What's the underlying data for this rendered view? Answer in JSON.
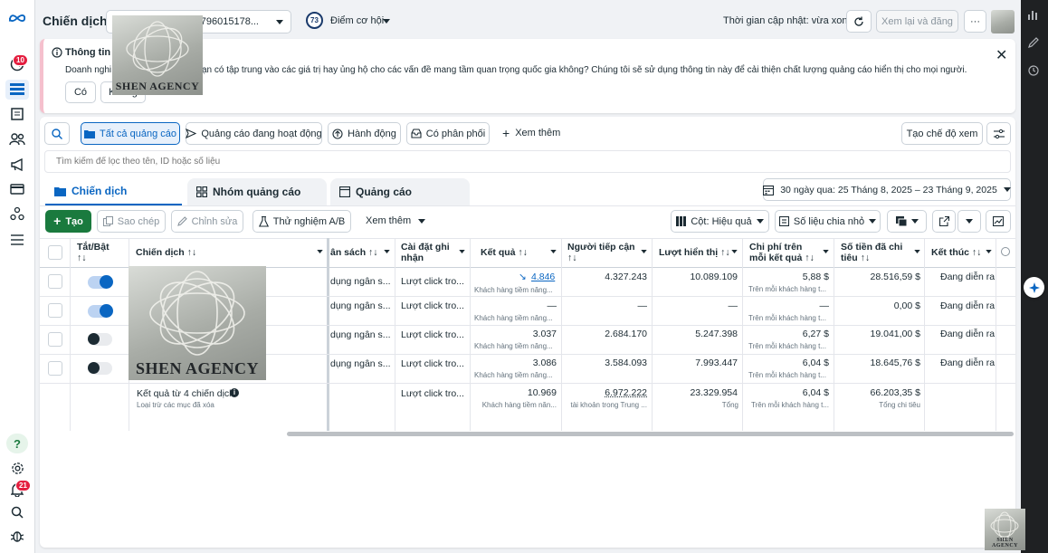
{
  "header": {
    "title": "Chiến dịch",
    "account_selector": "(1796015178...",
    "opportunity_score": "73",
    "opportunity_label": "Điểm cơ hội",
    "update_time": "Thời gian cập nhật: vừa xong",
    "review_publish": "Xem lại và đăng",
    "more": "···"
  },
  "banner": {
    "title": "Thông tin t",
    "text_left": "Doanh nghi",
    "text_right": "ạn có tập trung vào các giá trị hay ủng hộ cho các vấn đề mang tầm quan trọng quốc gia không? Chúng tôi sẽ sử dụng thông tin này để cải thiện chất lượng quảng cáo hiển thị cho mọi người.",
    "yes": "Có",
    "no": "Không"
  },
  "watermark": {
    "text": "SHEN AGENCY"
  },
  "filters": {
    "all_ads": "Tất cả quảng cáo",
    "active_ads": "Quảng cáo đang hoạt động",
    "actions": "Hành động",
    "delivery": "Có phân phối",
    "see_more": "Xem thêm",
    "create_view": "Tạo chế độ xem",
    "search_placeholder": "Tìm kiếm để lọc theo tên, ID hoặc số liệu"
  },
  "tabs": {
    "campaigns": "Chiến dịch",
    "adsets": "Nhóm quảng cáo",
    "ads": "Quảng cáo"
  },
  "date_range": "30 ngày qua: 25 Tháng 8, 2025 – 23 Tháng 9, 2025",
  "toolbar": {
    "create": "Tạo",
    "duplicate": "Sao chép",
    "edit": "Chỉnh sửa",
    "ab_test": "Thử nghiệm A/B",
    "more": "Xem thêm",
    "columns": "Cột: Hiệu quả",
    "breakdown": "Số liệu chia nhỏ"
  },
  "table": {
    "headers": {
      "onoff": "Tắt/Bật",
      "onoff_sort": "↑↓",
      "campaign": "Chiến dịch ↑↓",
      "budget": "ân sách ↑↓",
      "attribution": "Cài đặt ghi nhận",
      "results": "Kết quả ↑↓",
      "reach": "Người tiếp cận",
      "reach_sort": "↑↓",
      "impressions": "Lượt hiển thị ↑↓",
      "cost_per_result": "Chi phí trên mỗi kết quả ↑↓",
      "amount_spent": "Số tiền đã chi tiêu ↑↓",
      "end": "Kết thúc ↑↓"
    },
    "rows": [
      {
        "on": true,
        "budget": "dụng ngân s...",
        "attribution": "Lượt click tro...",
        "results": "4.846",
        "results_sub": "Khách hàng tiềm năng...",
        "reach": "4.327.243",
        "impressions": "10.089.109",
        "cpr": "5,88 $",
        "cpr_sub": "Trên mỗi khách hàng t...",
        "spent": "28.516,59 $",
        "end": "Đang diễn ra"
      },
      {
        "on": true,
        "budget": "dụng ngân s...",
        "attribution": "Lượt click tro...",
        "results": "—",
        "results_sub": "Khách hàng tiềm năng...",
        "reach": "—",
        "impressions": "—",
        "cpr": "—",
        "cpr_sub": "Trên mỗi khách hàng t...",
        "spent": "0,00 $",
        "end": "Đang diễn ra"
      },
      {
        "on": false,
        "budget": "dụng ngân s...",
        "attribution": "Lượt click tro...",
        "results": "3.037",
        "results_sub": "Khách hàng tiềm năng...",
        "reach": "2.684.170",
        "impressions": "5.247.398",
        "cpr": "6,27 $",
        "cpr_sub": "Trên mỗi khách hàng t...",
        "spent": "19.041,00 $",
        "end": "Đang diễn ra"
      },
      {
        "on": false,
        "budget": "dụng ngân s...",
        "attribution": "Lượt click tro...",
        "results": "3.086",
        "results_sub": "Khách hàng tiềm năng...",
        "reach": "3.584.093",
        "impressions": "7.993.447",
        "cpr": "6,04 $",
        "cpr_sub": "Trên mỗi khách hàng t...",
        "spent": "18.645,76 $",
        "end": "Đang diễn ra"
      }
    ],
    "summary": {
      "title": "Kết quả từ 4 chiến dịch",
      "subtitle": "Loại trừ các mục đã xóa",
      "attribution": "Lượt click tro...",
      "results": "10.969",
      "results_sub": "Khách hàng tiềm năn...",
      "reach": "6.972.222",
      "reach_sub": "tài khoản trong Trung ...",
      "impressions": "23.329.954",
      "impressions_sub": "Tổng",
      "cpr": "6,04 $",
      "cpr_sub": "Trên mỗi khách hàng t...",
      "spent": "66.203,35 $",
      "spent_sub": "Tổng chi tiêu"
    }
  },
  "rail": {
    "notif_badge": "10",
    "alert_badge": "21"
  },
  "colors": {
    "primary": "#0a66c2",
    "create_btn": "#1a7a3e",
    "badge": "#e41e3f"
  }
}
